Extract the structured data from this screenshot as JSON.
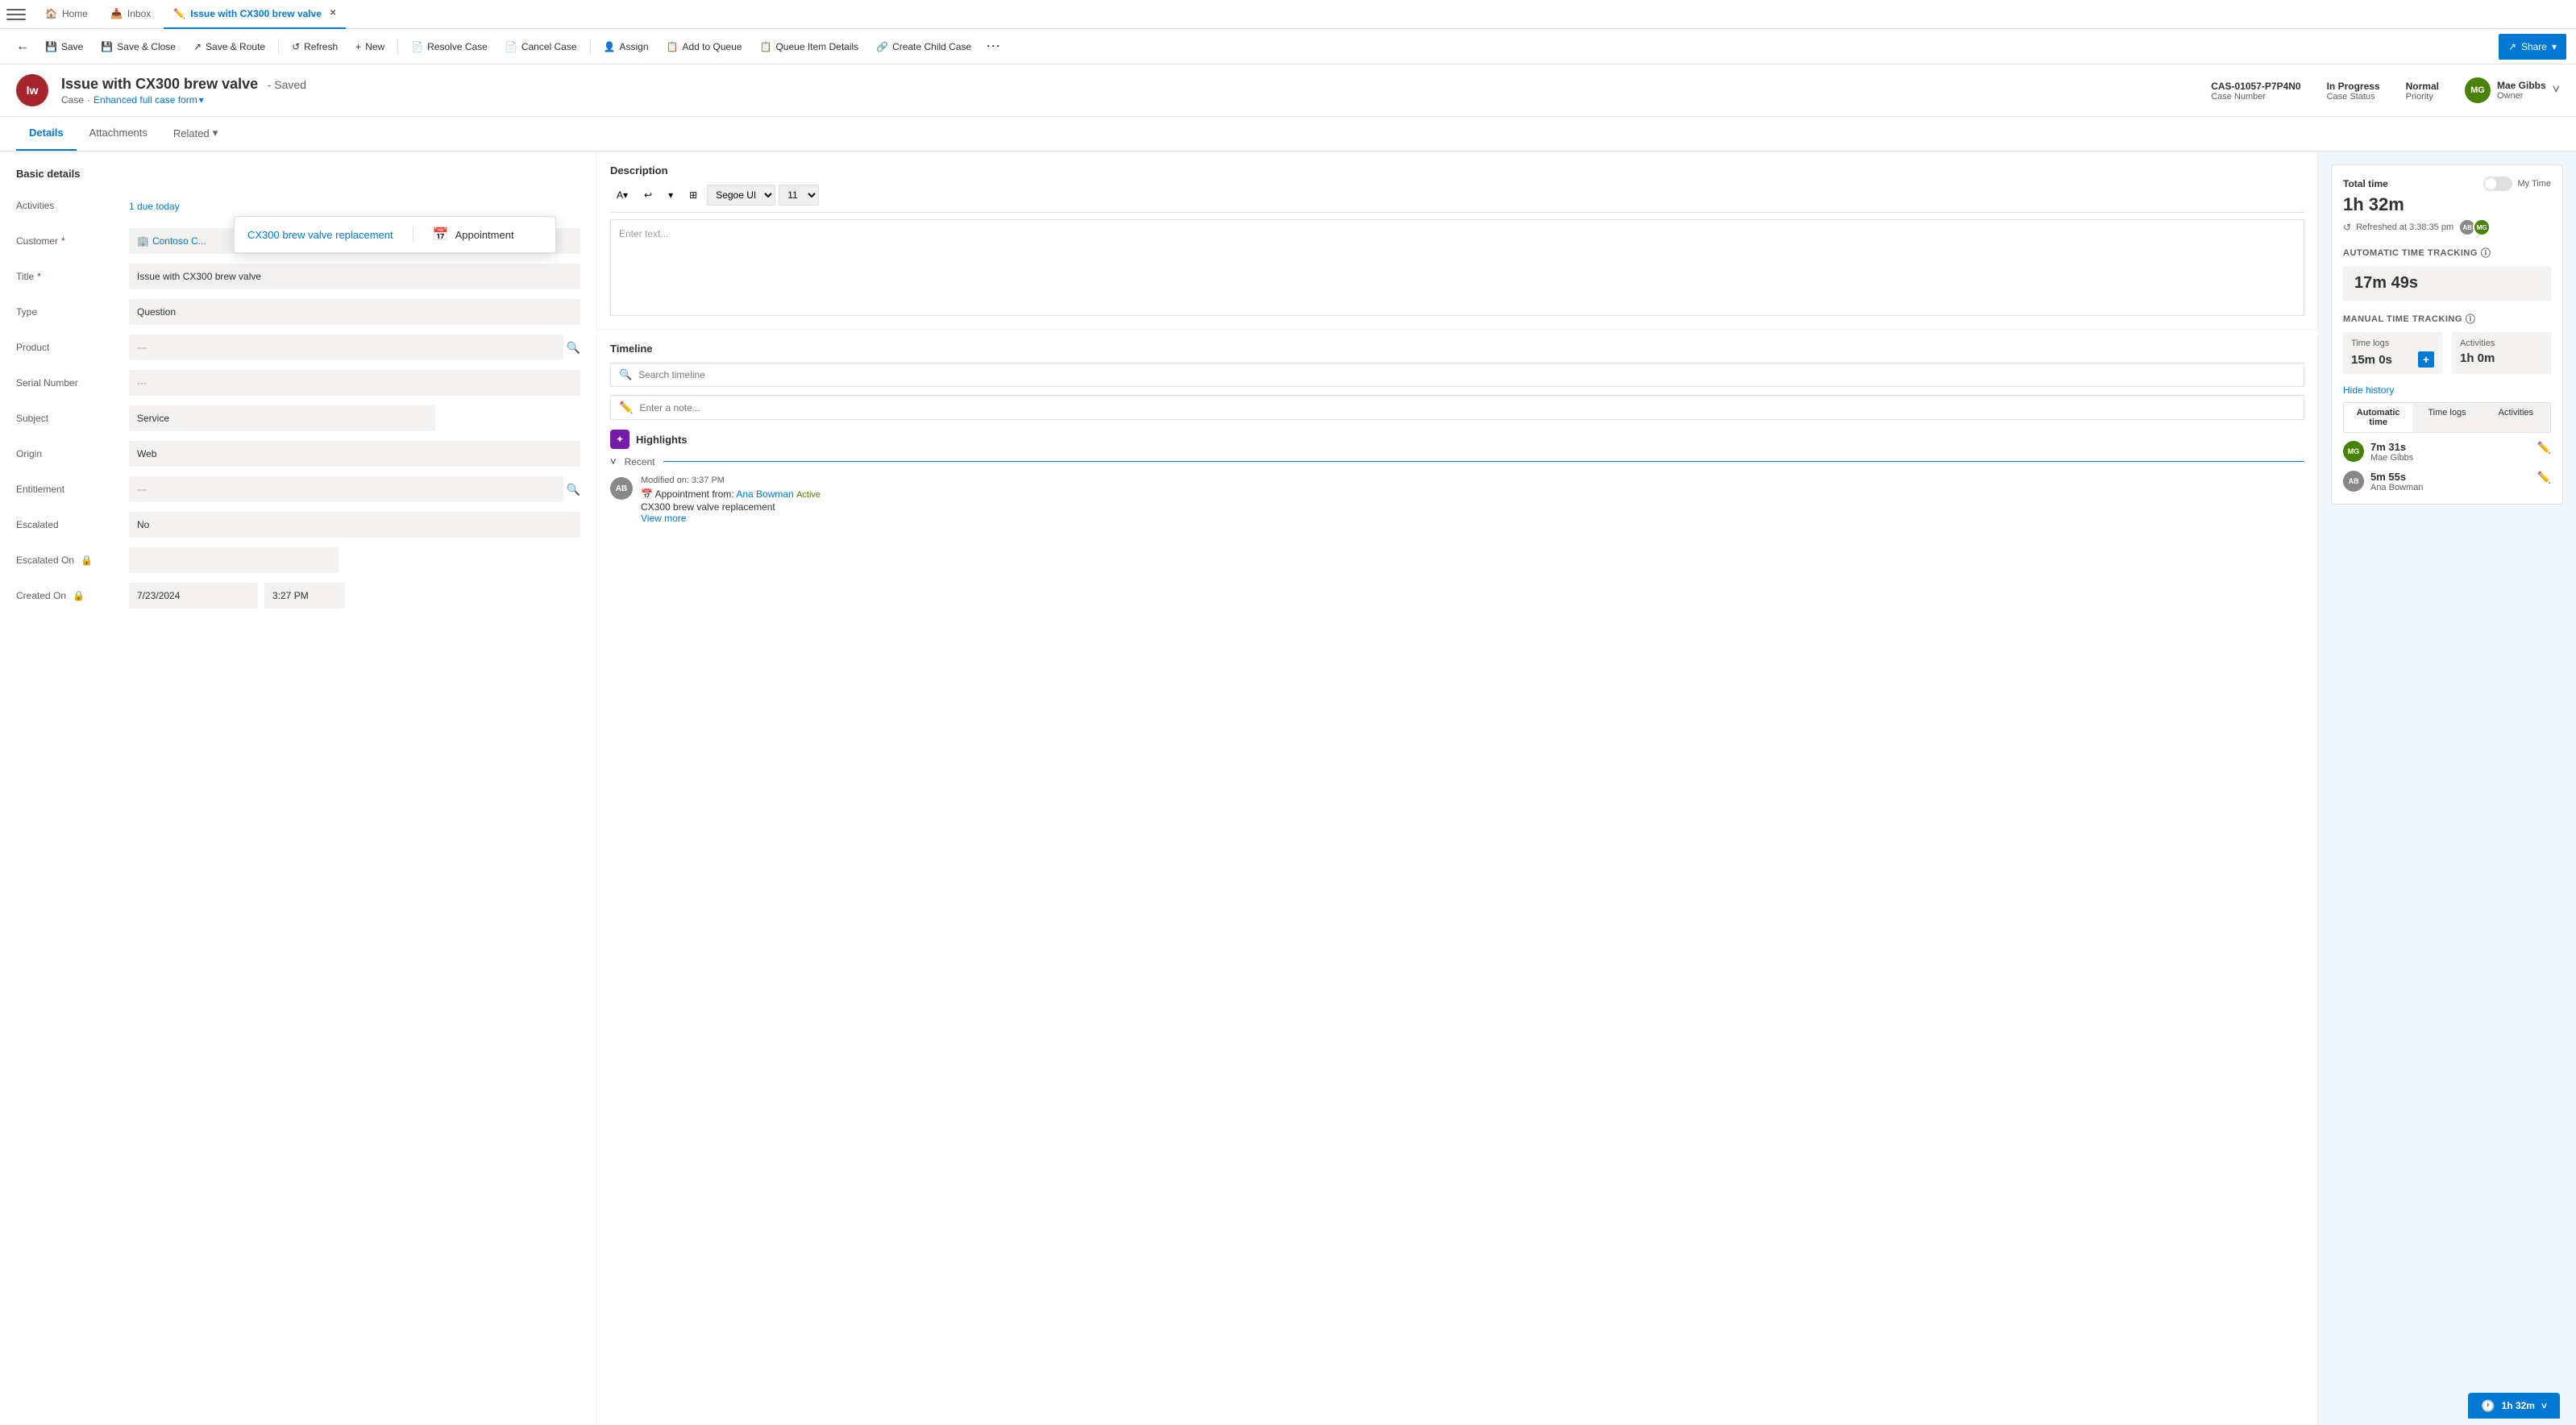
{
  "tabs": {
    "hamburger": "☰",
    "items": [
      {
        "id": "home",
        "label": "Home",
        "icon": "🏠",
        "active": false,
        "closable": false
      },
      {
        "id": "inbox",
        "label": "Inbox",
        "icon": "📥",
        "active": false,
        "closable": false
      },
      {
        "id": "case",
        "label": "Issue with CX300 brew valve",
        "icon": "✏️",
        "active": true,
        "closable": true
      }
    ]
  },
  "commandBar": {
    "back_icon": "←",
    "buttons": [
      {
        "id": "save",
        "label": "Save",
        "icon": "💾"
      },
      {
        "id": "save-close",
        "label": "Save & Close",
        "icon": "💾"
      },
      {
        "id": "save-route",
        "label": "Save & Route",
        "icon": "↗"
      },
      {
        "id": "refresh",
        "label": "Refresh",
        "icon": "↺"
      },
      {
        "id": "new",
        "label": "New",
        "icon": "+"
      },
      {
        "id": "resolve",
        "label": "Resolve Case",
        "icon": "📄"
      },
      {
        "id": "cancel",
        "label": "Cancel Case",
        "icon": "📄"
      },
      {
        "id": "assign",
        "label": "Assign",
        "icon": "👤"
      },
      {
        "id": "add-queue",
        "label": "Add to Queue",
        "icon": "📋"
      },
      {
        "id": "queue-details",
        "label": "Queue Item Details",
        "icon": "📋"
      },
      {
        "id": "child-case",
        "label": "Create Child Case",
        "icon": "🔗"
      }
    ],
    "more": "⋯",
    "share": "Share",
    "share_icon": "↗"
  },
  "header": {
    "avatar_initials": "lw",
    "title": "Issue with CX300 brew valve",
    "saved_text": "- Saved",
    "breadcrumb_type": "Case",
    "form_label": "Enhanced full case form",
    "case_number": "CAS-01057-P7P4N0",
    "case_number_label": "Case Number",
    "status": "In Progress",
    "status_label": "Case Status",
    "priority": "Normal",
    "priority_label": "Priority",
    "owner_initials": "MG",
    "owner_name": "Mae Gibbs",
    "owner_role": "Owner",
    "expand_icon": "˅"
  },
  "navTabs": [
    {
      "id": "details",
      "label": "Details",
      "active": true
    },
    {
      "id": "attachments",
      "label": "Attachments",
      "active": false
    },
    {
      "id": "related",
      "label": "Related",
      "active": false,
      "has_dropdown": true
    }
  ],
  "basicDetails": {
    "section_title": "Basic details",
    "fields": [
      {
        "id": "activities",
        "label": "Activities",
        "value": "1 due today",
        "type": "link",
        "required": false
      },
      {
        "id": "customer",
        "label": "Customer",
        "value": "Contoso C...",
        "type": "link-search",
        "required": true,
        "icon": "🏢"
      },
      {
        "id": "title",
        "label": "Title",
        "value": "Issue with CX300 brew valve",
        "type": "text",
        "required": true
      },
      {
        "id": "type",
        "label": "Type",
        "value": "Question",
        "type": "text",
        "required": false
      },
      {
        "id": "product",
        "label": "Product",
        "value": "---",
        "type": "search",
        "required": false
      },
      {
        "id": "serial-number",
        "label": "Serial Number",
        "value": "---",
        "type": "text",
        "required": false
      },
      {
        "id": "subject",
        "label": "Subject",
        "value": "Service",
        "type": "text",
        "required": false
      },
      {
        "id": "origin",
        "label": "Origin",
        "value": "Web",
        "type": "text",
        "required": false
      },
      {
        "id": "entitlement",
        "label": "Entitlement",
        "value": "---",
        "type": "search",
        "required": false
      },
      {
        "id": "escalated",
        "label": "Escalated",
        "value": "No",
        "type": "text",
        "required": false
      },
      {
        "id": "escalated-on",
        "label": "Escalated On",
        "value": "",
        "type": "locked",
        "required": false
      },
      {
        "id": "created-on",
        "label": "Created On",
        "value": "7/23/2024",
        "type": "datetime",
        "time": "3:27 PM",
        "required": false,
        "locked": true
      }
    ]
  },
  "popup": {
    "link_text": "CX300 brew valve replacement",
    "appointment_label": "Appointment",
    "cal_icon": "📅"
  },
  "description": {
    "title": "Description",
    "toolbar": {
      "font_icon": "A",
      "undo_icon": "↩",
      "undo_dropdown": "▾",
      "format_icon": "⊞",
      "font_name": "Segoe UI",
      "font_size": "11"
    },
    "placeholder": "Enter text..."
  },
  "timeline": {
    "title": "Timeline",
    "search_placeholder": "Search timeline",
    "note_placeholder": "Enter a note...",
    "highlights_label": "Highlights",
    "highlights_icon": "✦",
    "recent_label": "Recent",
    "entries": [
      {
        "id": "entry-1",
        "avatar_initials": "AB",
        "avatar_color": "#8a8886",
        "modified_label": "Modified on: 3:37 PM",
        "appointment_prefix": "Appointment from:",
        "person": "Ana Bowman",
        "status": "Active",
        "subject": "CX300 brew valve replacement",
        "view_more": "View more"
      }
    ]
  },
  "timeTracking": {
    "total_time_label": "Total time",
    "total_time_value": "1h 32m",
    "my_time_label": "My Time",
    "refreshed_label": "Refreshed at 3:38:35 pm",
    "avatar1_initials": "AB",
    "avatar1_color": "#8a8886",
    "avatar2_initials": "MG",
    "avatar2_color": "#498205",
    "auto_tracking_label": "AUTOMATIC TIME TRACKING",
    "auto_tracking_value": "17m 49s",
    "manual_tracking_label": "MANUAL TIME TRACKING",
    "time_logs_label": "Time logs",
    "time_logs_value": "15m 0s",
    "activities_label": "Activities",
    "activities_value": "1h 0m",
    "hide_history_label": "Hide history",
    "history_tabs": [
      {
        "id": "automatic",
        "label": "Automatic time",
        "active": true
      },
      {
        "id": "timelogs",
        "label": "Time logs",
        "active": false
      },
      {
        "id": "activities-tab",
        "label": "Activities",
        "active": false
      }
    ],
    "history_entries": [
      {
        "id": "mg",
        "initials": "MG",
        "color": "#498205",
        "time": "7m 31s",
        "name": "Mae Gibbs"
      },
      {
        "id": "ab",
        "initials": "AB",
        "color": "#8a8886",
        "time": "5m 55s",
        "name": "Ana Bowman"
      }
    ]
  },
  "bottomBar": {
    "icon": "🕐",
    "label": "1h 32m",
    "dropdown_icon": "˅"
  }
}
